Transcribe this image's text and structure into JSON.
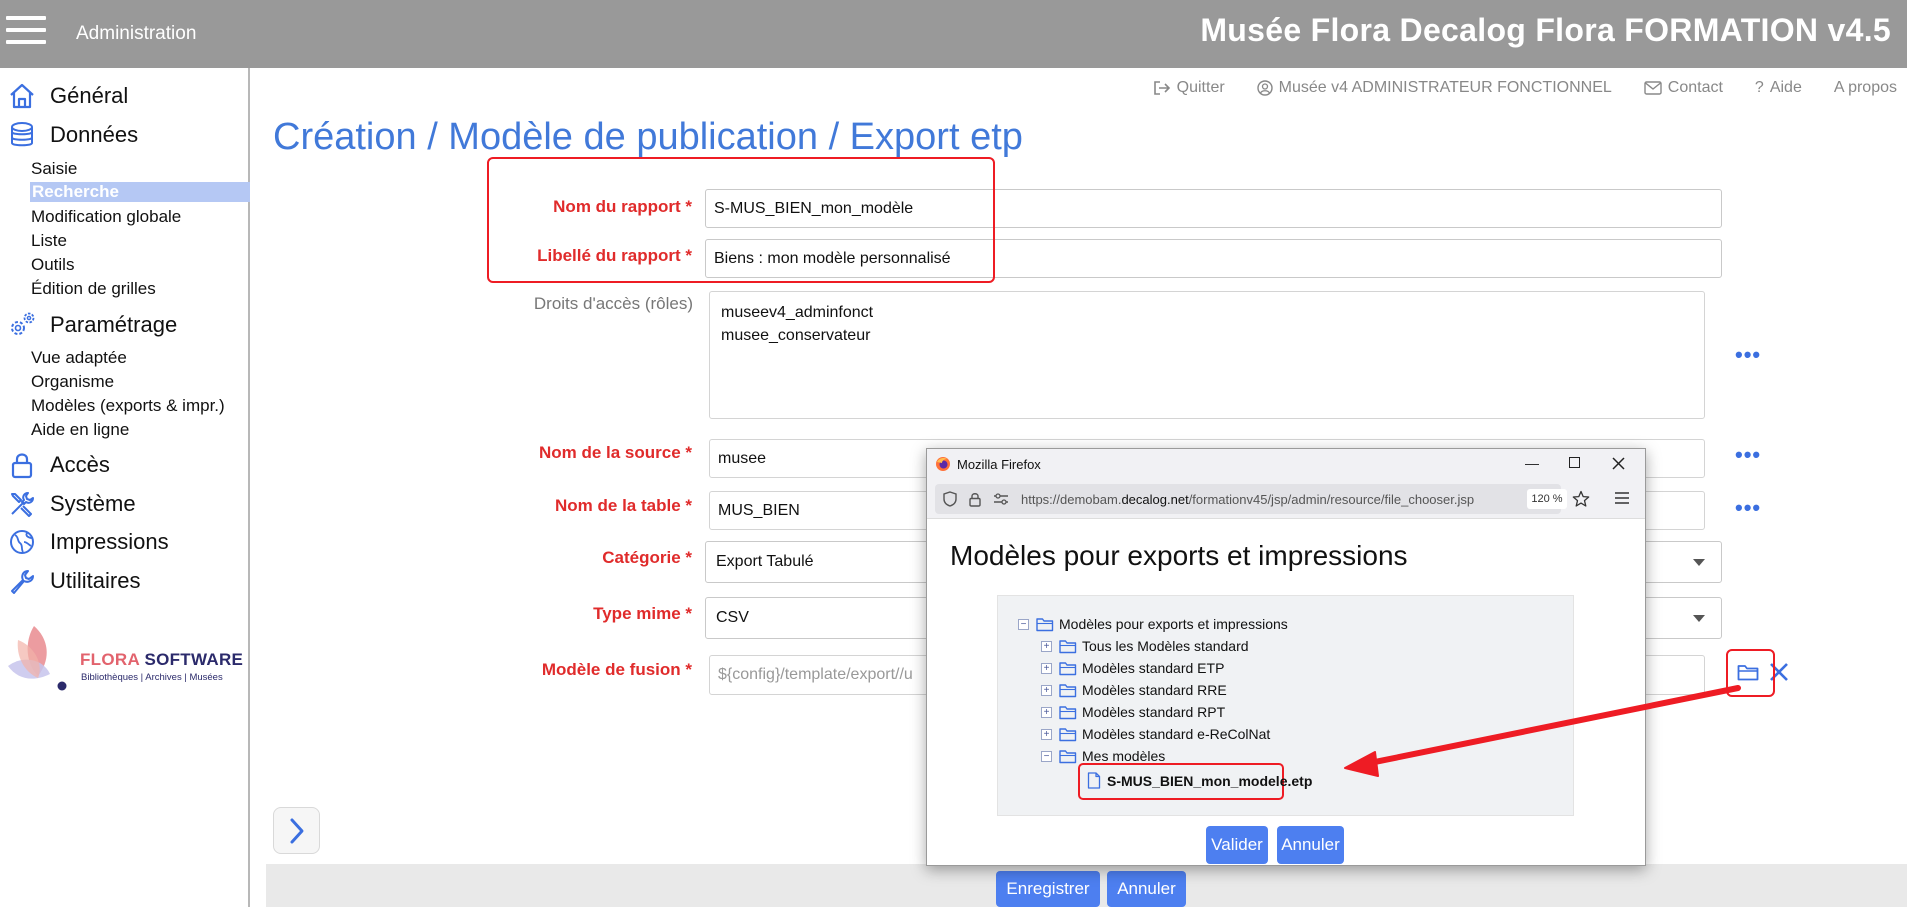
{
  "topbar": {
    "section": "Administration",
    "app_title": "Musée Flora Decalog Flora FORMATION v4.5"
  },
  "sidebar": {
    "general": "Général",
    "donnees": "Données",
    "donnees_items": [
      "Saisie",
      "Recherche",
      "Modification globale",
      "Liste",
      "Outils",
      "Édition de grilles"
    ],
    "parametrage": "Paramétrage",
    "parametrage_items": [
      "Vue adaptée",
      "Organisme",
      "Modèles (exports & impr.)",
      "Aide en ligne"
    ],
    "acces": "Accès",
    "systeme": "Système",
    "impressions": "Impressions",
    "utilitaires": "Utilitaires",
    "logo": {
      "flora": "FLORA",
      "software": "SOFTWARE",
      "tagline": "Bibliothèques | Archives | Musées"
    }
  },
  "header_links": {
    "quitter": "Quitter",
    "user": "Musée v4 ADMINISTRATEUR FONCTIONNEL",
    "contact": "Contact",
    "aide": "Aide",
    "apropos": "A propos"
  },
  "page_title": "Création / Modèle de publication / Export etp",
  "form": {
    "nom_rapport": {
      "label": "Nom du rapport *",
      "value": "S-MUS_BIEN_mon_modèle"
    },
    "libelle_rapport": {
      "label": "Libellé du rapport *",
      "value": "Biens : mon modèle personnalisé"
    },
    "droits": {
      "label": "Droits d'accès (rôles)",
      "values": [
        "museev4_adminfonct",
        "musee_conservateur"
      ]
    },
    "nom_source": {
      "label": "Nom de la source *",
      "value": "musee"
    },
    "nom_table": {
      "label": "Nom de la table *",
      "value": "MUS_BIEN"
    },
    "categorie": {
      "label": "Catégorie *",
      "value": "Export Tabulé"
    },
    "type_mime": {
      "label": "Type mime *",
      "value": "CSV"
    },
    "modele_fusion": {
      "label": "Modèle de fusion *",
      "placeholder": "${config}/template/export//u"
    },
    "more": "•••"
  },
  "buttons": {
    "enregistrer": "Enregistrer",
    "annuler": "Annuler"
  },
  "dialog": {
    "window_title": "Mozilla Firefox",
    "url_prefix": "https://demobam.",
    "url_domain": "decalog.net",
    "url_path": "/formationv45/jsp/admin/resource/file_chooser.jsp",
    "zoom": "120 %",
    "heading": "Modèles pour exports et impressions",
    "tree": {
      "root": "Modèles pour exports et impressions",
      "children": [
        "Tous les Modèles standard",
        "Modèles standard ETP",
        "Modèles standard RRE",
        "Modèles standard RPT",
        "Modèles standard e-ReColNat",
        "Mes modèles"
      ],
      "selected_file": "S-MUS_BIEN_mon_modele.etp"
    },
    "valider": "Valider",
    "annuler": "Annuler"
  },
  "colors": {
    "accent": "#4179d9",
    "required": "#e02b2b",
    "button": "#4d7ff0",
    "highlight": "#ee1c24",
    "topbar": "#999999"
  }
}
